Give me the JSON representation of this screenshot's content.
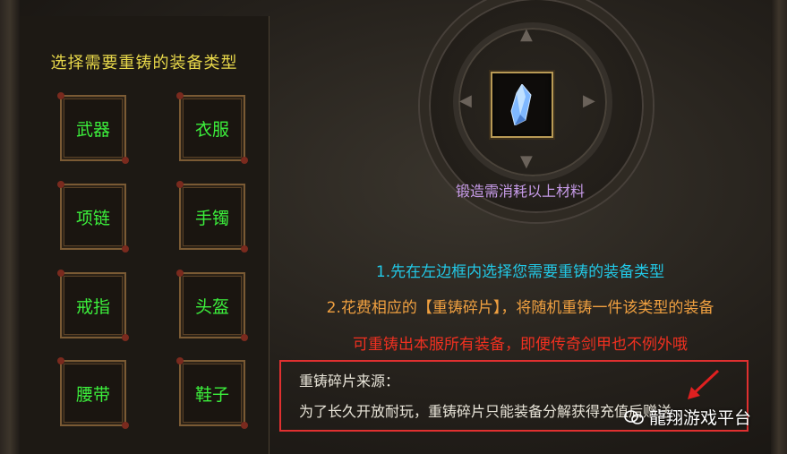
{
  "left_panel": {
    "title": "选择需要重铸的装备类型",
    "slots": [
      "武器",
      "衣服",
      "项链",
      "手镯",
      "戒指",
      "头盔",
      "腰带",
      "鞋子"
    ]
  },
  "forge": {
    "material_hint": "锻造需消耗以上材料",
    "material_icon": "crystal-shard-icon"
  },
  "instructions": {
    "line1": "1.先在左边框内选择您需要重铸的装备类型",
    "line2": "2.花费相应的【重铸碎片】，将随机重铸一件该类型的装备",
    "line3": "可重铸出本服所有装备，即便传奇剑甲也不例外哦"
  },
  "source": {
    "title": "重铸碎片来源：",
    "text": "为了长久开放耐玩，重铸碎片只能装备分解获得充值后赠送"
  },
  "watermark": {
    "text": "龍翔游戏平台"
  },
  "colors": {
    "slot_text": "#3cf03c",
    "title": "#e8d84a",
    "hint": "#c79be9",
    "line1": "#22c8e6",
    "line2": "#f0a040",
    "line3": "#f03020",
    "highlight_box": "#e03030"
  }
}
